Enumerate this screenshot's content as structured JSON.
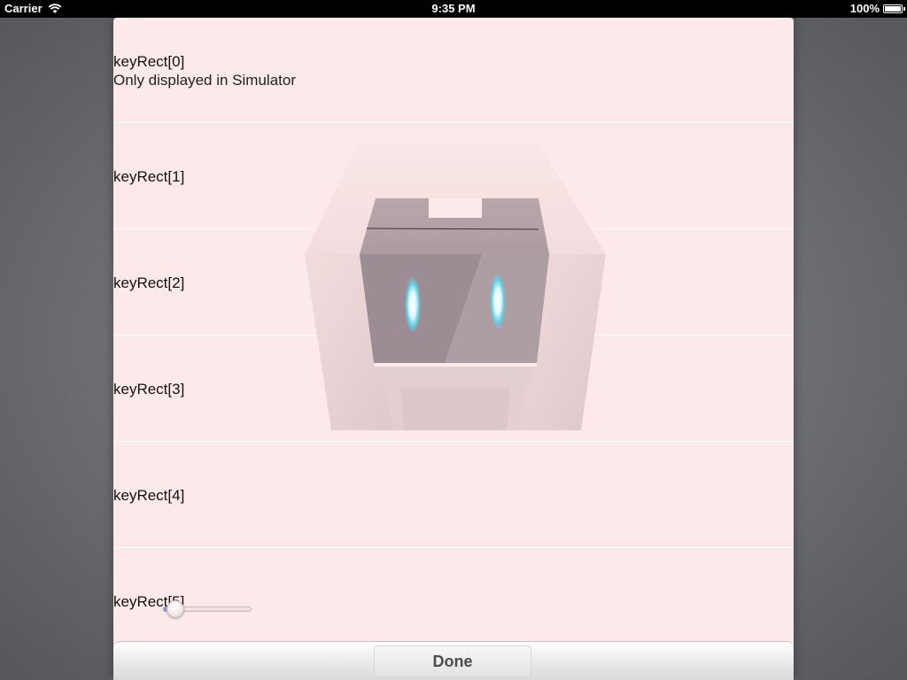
{
  "status_bar": {
    "carrier": "Carrier",
    "time": "9:35 PM",
    "battery": "100%"
  },
  "rows": [
    {
      "label": "keyRect[0]",
      "sublabel": "Only displayed in Simulator"
    },
    {
      "label": "keyRect[1]"
    },
    {
      "label": "keyRect[2]"
    },
    {
      "label": "keyRect[3]"
    },
    {
      "label": "keyRect[4]"
    },
    {
      "label": "keyRect[5]"
    }
  ],
  "slider": {
    "value": 0.05
  },
  "toolbar": {
    "done_label": "Done"
  },
  "icons": {
    "wifi": "wifi-icon",
    "battery": "battery-icon",
    "logo": "cordova-logo-icon"
  },
  "colors": {
    "sheet_background": "#fde9ea",
    "slider_fill": "#8d9ad6"
  }
}
